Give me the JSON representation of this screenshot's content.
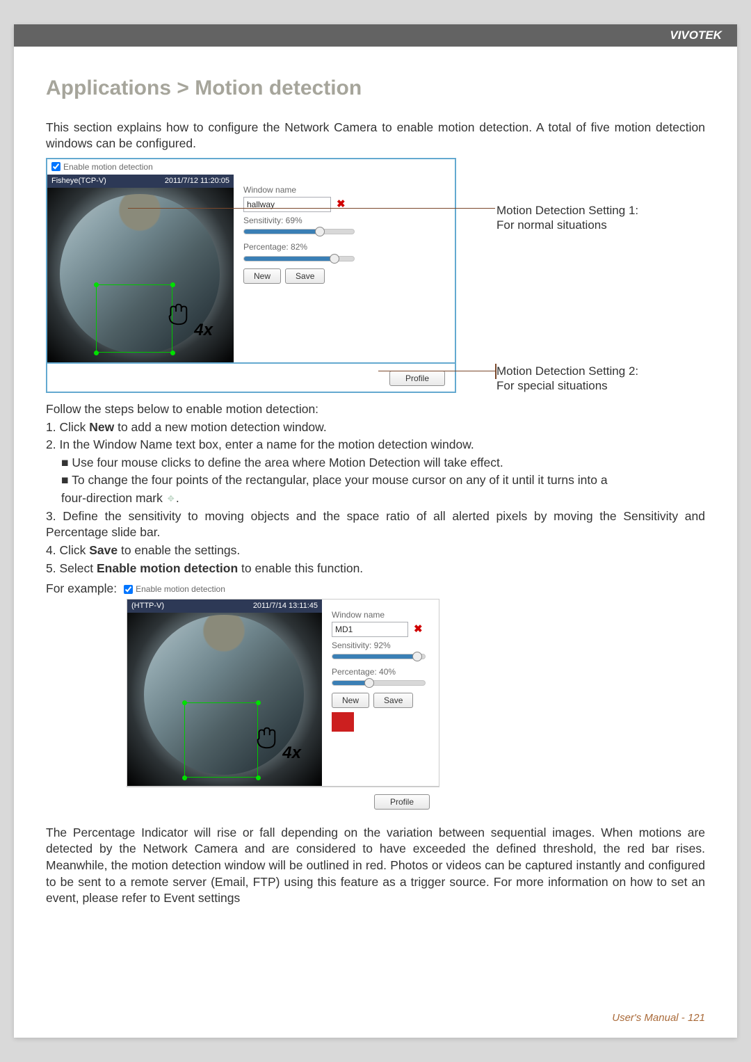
{
  "brand": "VIVOTEK",
  "title": "Applications > Motion detection",
  "intro": "This section explains how to configure the Network Camera to enable motion detection. A total of five motion detection windows can be configured.",
  "checkbox_label": "Enable motion detection",
  "fig1": {
    "stream_name": "Fisheye(TCP-V)",
    "timestamp": "2011/7/12 11:20:05",
    "window_name_label": "Window name",
    "window_name_value": "hallway",
    "sensitivity_label": "Sensitivity: 69%",
    "sensitivity_pct": 69,
    "percentage_label": "Percentage: 82%",
    "percentage_pct": 82,
    "new_btn": "New",
    "save_btn": "Save",
    "profile_btn": "Profile",
    "zoom": "4x"
  },
  "annot1_line1": "Motion Detection Setting 1:",
  "annot1_line2": "For normal situations",
  "annot2_line1": "Motion Detection Setting 2:",
  "annot2_line2": "For special situations",
  "steps_intro": "Follow the steps below to enable motion detection:",
  "step1_a": "1. Click ",
  "step1_b": "New",
  "step1_c": " to add a new motion detection window.",
  "step2": "2. In the Window Name text box, enter a name for the motion detection window.",
  "step2_sub1": "■ Use four mouse clicks to define the area where Motion Detection will take effect.",
  "step2_sub2a": "■ To change the four points of the rectangular, place your mouse cursor on any of it until it turns into a",
  "step2_sub2b": "four-direction mark ",
  "step2_sub2c": ".",
  "step3": "3. Define the sensitivity to moving objects and the space ratio of all alerted pixels by moving the Sensitivity and Percentage slide bar.",
  "step4_a": "4. Click ",
  "step4_b": "Save",
  "step4_c": " to enable the settings.",
  "step5_a": "5. Select ",
  "step5_b": "Enable motion detection",
  "step5_c": " to enable this function.",
  "example_label": "For example:",
  "fig2": {
    "stream_name": "(HTTP-V)",
    "timestamp": "2011/7/14 13:11:45",
    "window_name_label": "Window name",
    "window_name_value": "MD1",
    "sensitivity_label": "Sensitivity: 92%",
    "sensitivity_pct": 92,
    "percentage_label": "Percentage: 40%",
    "percentage_pct": 40,
    "new_btn": "New",
    "save_btn": "Save",
    "profile_btn": "Profile",
    "zoom": "4x"
  },
  "after_para": "The Percentage Indicator will rise or fall depending on the variation between sequential images. When motions are detected by the Network Camera and are considered to have exceeded the defined threshold, the red bar rises. Meanwhile, the motion detection window will be outlined in red. Photos or videos can be captured instantly and configured to be sent to a remote server (Email, FTP) using this feature as a trigger source. For more information on how to set an event, please refer to Event settings",
  "footer": "User's Manual - 121"
}
